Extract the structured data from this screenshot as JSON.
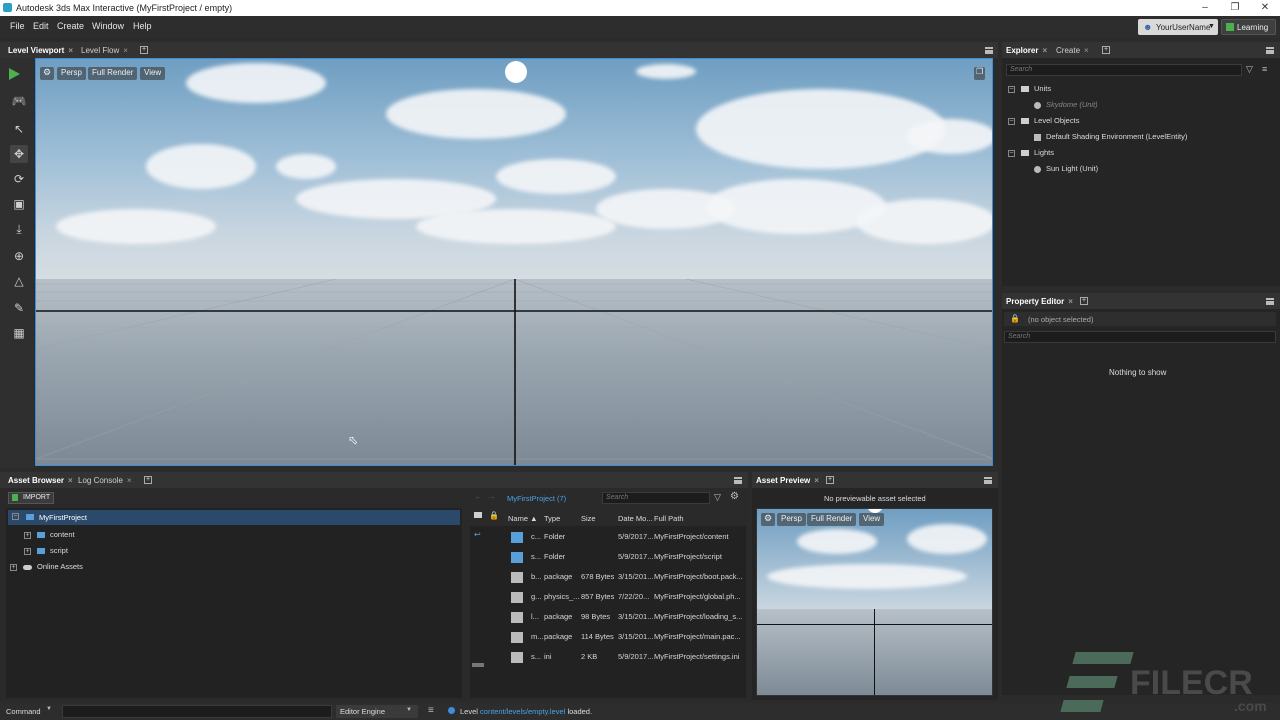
{
  "window": {
    "title": "Autodesk 3ds Max Interactive (MyFirstProject / empty)"
  },
  "menu": [
    "File",
    "Edit",
    "Create",
    "Window",
    "Help"
  ],
  "user": {
    "name": "YourUserName",
    "learning": "Learning"
  },
  "top_tabs": {
    "level_viewport": "Level Viewport",
    "level_flow": "Level Flow"
  },
  "viewport": {
    "persp": "Persp",
    "full_render": "Full Render",
    "view": "View"
  },
  "explorer": {
    "tabs": {
      "explorer": "Explorer",
      "create": "Create"
    },
    "search_placeholder": "Search",
    "tree": [
      {
        "label": "Units",
        "group": true
      },
      {
        "label": "Skydome (Unit)",
        "group": false,
        "dim": true
      },
      {
        "label": "Level Objects",
        "group": true
      },
      {
        "label": "Default Shading Environment (LevelEntity)",
        "group": false
      },
      {
        "label": "Lights",
        "group": true
      },
      {
        "label": "Sun Light (Unit)",
        "group": false
      }
    ]
  },
  "property_editor": {
    "tab": "Property Editor",
    "selection": "(no object selected)",
    "search_placeholder": "Search",
    "empty": "Nothing to show"
  },
  "asset_browser": {
    "tabs": {
      "asset_browser": "Asset Browser",
      "log_console": "Log Console"
    },
    "import": "IMPORT",
    "project_label": "MyFirstProject (7)",
    "search_placeholder": "Search",
    "tree": [
      "MyFirstProject",
      "content",
      "script",
      "Online Assets"
    ],
    "columns": [
      "Name ▲",
      "Type",
      "Size",
      "Date Mo...",
      "Full Path"
    ],
    "rows": [
      {
        "name": "c...",
        "type": "Folder",
        "size": "",
        "date": "5/9/2017...",
        "path": "MyFirstProject/content",
        "kind": "folder"
      },
      {
        "name": "s...",
        "type": "Folder",
        "size": "",
        "date": "5/9/2017...",
        "path": "MyFirstProject/script",
        "kind": "folder"
      },
      {
        "name": "b...",
        "type": "package",
        "size": "678 Bytes",
        "date": "3/15/201...",
        "path": "MyFirstProject/boot.pack...",
        "kind": "file"
      },
      {
        "name": "g...",
        "type": "physics_...",
        "size": "857 Bytes",
        "date": "7/22/20...",
        "path": "MyFirstProject/global.ph...",
        "kind": "file"
      },
      {
        "name": "l...",
        "type": "package",
        "size": "98 Bytes",
        "date": "3/15/201...",
        "path": "MyFirstProject/loading_s...",
        "kind": "file"
      },
      {
        "name": "m...",
        "type": "package",
        "size": "114 Bytes",
        "date": "3/15/201...",
        "path": "MyFirstProject/main.pac...",
        "kind": "file"
      },
      {
        "name": "s...",
        "type": "ini",
        "size": "2 KB",
        "date": "5/9/2017...",
        "path": "MyFirstProject/settings.ini",
        "kind": "file"
      }
    ]
  },
  "asset_preview": {
    "tab": "Asset Preview",
    "message": "No previewable asset selected"
  },
  "statusbar": {
    "command": "Command",
    "engine": "Editor Engine",
    "msg_prefix": "Level",
    "msg_link": "content/levels/empty.level",
    "msg_suffix": "loaded."
  },
  "watermark": {
    "brand": "FILECR",
    "domain": ".com"
  },
  "colors": {
    "accent": "#3a8fd8",
    "play": "#4caf50",
    "selection": "#2b4a6b",
    "link": "#4aa3e6"
  }
}
